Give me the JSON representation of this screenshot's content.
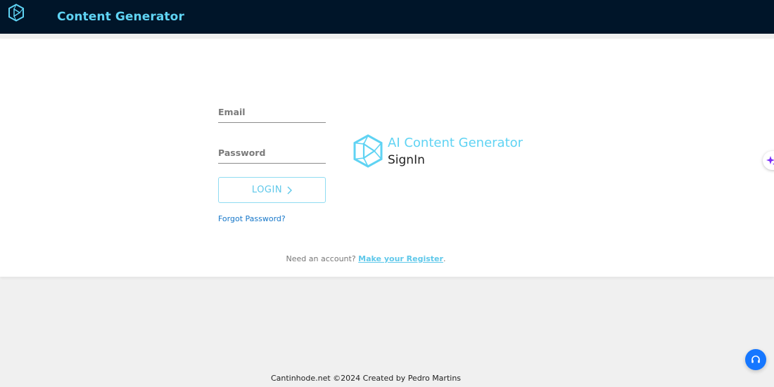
{
  "header": {
    "app_title": "Content Generator",
    "logo_icon": "hexagon-play-logo-icon",
    "background_color": "#001529",
    "accent_color": "#5fd3f3"
  },
  "login_form": {
    "email_placeholder": "Email",
    "email_value": "",
    "password_placeholder": "Password",
    "password_value": "",
    "login_label": "LOGIN",
    "login_icon": "chevron-right-icon",
    "forgot_label": "Forgot Password?"
  },
  "brand": {
    "title": "AI Content Generator",
    "subtitle": "SignIn",
    "logo_icon": "hexagon-play-logo-icon"
  },
  "register": {
    "prompt": "Need an account?",
    "link_label": "Make your Register",
    "suffix": "."
  },
  "footer": {
    "text": "Cantinhode.net ©2024 Created by Pedro Martins"
  },
  "floating": {
    "side_tab_icon": "sparkle-icon",
    "help_icon": "headset-icon",
    "help_color": "#1677ff"
  }
}
